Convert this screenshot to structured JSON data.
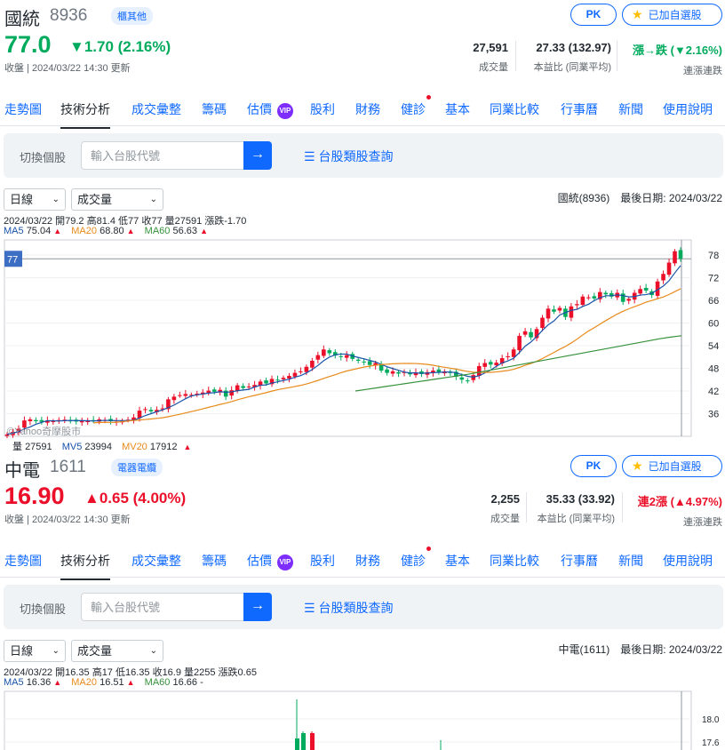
{
  "stocks": [
    {
      "name": "國統",
      "code": "8936",
      "sector": "櫃其他",
      "price": "77.0",
      "change": "▼1.70 (2.16%)",
      "direction": "down",
      "time": "收盤 | 2024/03/22 14:30 更新",
      "pk_label": "PK",
      "fav_label": "已加自選股",
      "volume": "27,591",
      "volume_label": "成交量",
      "pe": "27.33 (132.97)",
      "pe_label": "本益比 (同業平均)",
      "streak": "漲→跌 (▼2.16%)",
      "streak_label": "連漲連跌",
      "tabs": [
        "走勢圖",
        "技術分析",
        "成交彙整",
        "籌碼",
        "估價",
        "股利",
        "財務",
        "健診",
        "基本",
        "同業比較",
        "行事曆",
        "新聞",
        "使用說明"
      ],
      "vip_label": "VIP",
      "search": {
        "label": "切換個股",
        "placeholder": "輸入台股代號",
        "go": "→",
        "category": "☰ 台股類股查詢"
      },
      "period_select": "日線",
      "indicator_select": "成交量",
      "right_info": "國統(8936)　最後日期: 2024/03/22",
      "ohlc": "2024/03/22 開79.2 高81.4 低77 收77 量27591 漲跌-1.70",
      "ma": {
        "ma5_label": "MA5",
        "ma5": "75.04",
        "ma20_label": "MA20",
        "ma20": "68.80",
        "ma60_label": "MA60",
        "ma60": "56.63",
        "trend": "▲"
      },
      "volume_line": {
        "label": "量",
        "value": "27591",
        "mv5_label": "MV5",
        "mv5": "23994",
        "mv20_label": "MV20",
        "mv20": "17912",
        "trend": "▲"
      },
      "chart_data": {
        "type": "candlestick",
        "current_price_label": "77",
        "y_ticks": [
          "78",
          "72",
          "66",
          "60",
          "54",
          "48",
          "42",
          "36"
        ],
        "ylim": [
          30,
          82
        ],
        "close": [
          30.5,
          31.2,
          32.0,
          34.2,
          34.5,
          34.0,
          33.8,
          34.2,
          34.0,
          34.3,
          34.4,
          34.1,
          33.9,
          34.2,
          34.0,
          34.1,
          34.5,
          34.3,
          34.0,
          33.9,
          34.1,
          34.4,
          35.0,
          36.8,
          37.2,
          36.6,
          37.0,
          37.4,
          39.8,
          40.5,
          40.9,
          41.2,
          41.0,
          41.3,
          41.6,
          42.1,
          41.8,
          42.3,
          40.5,
          42.2,
          43.5,
          42.8,
          43.2,
          43.6,
          44.5,
          44.0,
          45.2,
          44.8,
          45.5,
          46.0,
          46.8,
          47.2,
          48.4,
          50.0,
          51.5,
          53.0,
          52.0,
          51.4,
          51.0,
          51.5,
          50.5,
          50.0,
          49.6,
          48.9,
          49.4,
          47.4,
          46.8,
          47.2,
          46.6,
          47.0,
          46.4,
          46.9,
          46.5,
          47.0,
          47.4,
          46.9,
          47.2,
          46.8,
          45.8,
          45.0,
          44.6,
          46.2,
          48.6,
          49.4,
          49.0,
          49.5,
          50.7,
          51.2,
          53.0,
          56.6,
          57.8,
          56.2,
          58.4,
          61.4,
          63.8,
          63.0,
          64.0,
          61.6,
          64.4,
          65.0,
          67.0,
          66.8,
          66.5,
          68.2,
          67.6,
          67.0,
          68.0,
          65.6,
          66.4,
          68.0,
          69.0,
          68.6,
          67.4,
          71.0,
          73.0,
          76.0,
          79.0,
          77.0
        ],
        "ma60": [
          42.0,
          42.4,
          42.8,
          43.2,
          43.6,
          44.0,
          44.4,
          44.8,
          45.2,
          45.6,
          46.0,
          46.4,
          46.9,
          47.4,
          47.9,
          48.4,
          48.9,
          49.4,
          49.9,
          50.4,
          50.9,
          51.4,
          51.9,
          52.4,
          52.9,
          53.4,
          53.9,
          54.4,
          54.9,
          55.4,
          55.9,
          56.3,
          56.63
        ]
      }
    },
    {
      "name": "中電",
      "code": "1611",
      "sector": "電器電纜",
      "price": "16.90",
      "change": "▲0.65 (4.00%)",
      "direction": "up",
      "time": "收盤 | 2024/03/22 14:30 更新",
      "pk_label": "PK",
      "fav_label": "已加自選股",
      "volume": "2,255",
      "volume_label": "成交量",
      "pe": "35.33 (33.92)",
      "pe_label": "本益比 (同業平均)",
      "streak": "連2漲 (▲4.97%)",
      "streak_label": "連漲連跌",
      "tabs": [
        "走勢圖",
        "技術分析",
        "成交彙整",
        "籌碼",
        "估價",
        "股利",
        "財務",
        "健診",
        "基本",
        "同業比較",
        "行事曆",
        "新聞",
        "使用說明"
      ],
      "vip_label": "VIP",
      "search": {
        "label": "切換個股",
        "placeholder": "輸入台股代號",
        "go": "→",
        "category": "☰ 台股類股查詢"
      },
      "period_select": "日線",
      "indicator_select": "成交量",
      "right_info": "中電(1611)　最後日期: 2024/03/22",
      "ohlc": "2024/03/22 開16.35 高17 低16.35 收16.9 量2255 漲跌0.65",
      "ma": {
        "ma5_label": "MA5",
        "ma5": "16.36",
        "ma20_label": "MA20",
        "ma20": "16.51",
        "ma60_label": "MA60",
        "ma60": "16.66",
        "trend": "▲",
        "ma60_trend": "-"
      },
      "chart_data": {
        "type": "candlestick",
        "y_ticks": [
          "18.0",
          "17.6"
        ]
      }
    }
  ],
  "watermark": "©Yahoo奇摩股市"
}
